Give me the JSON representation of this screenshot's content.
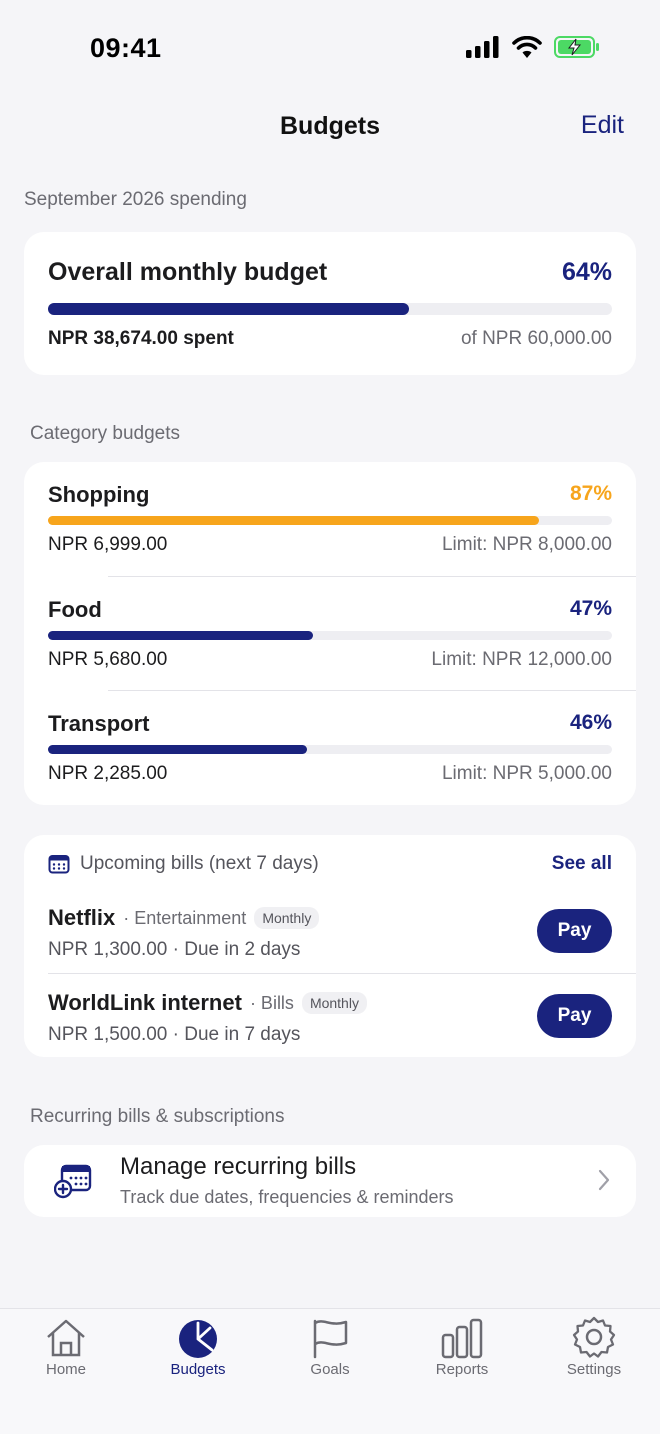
{
  "status_bar": {
    "time": "09:41"
  },
  "nav": {
    "title": "Budgets",
    "edit_label": "Edit"
  },
  "spending": {
    "section_label": "September 2026 spending",
    "title": "Overall monthly budget",
    "percent_label": "64%",
    "progress": 0.64,
    "spent": "NPR 38,674.00 spent",
    "of_total": "of NPR 60,000.00"
  },
  "categories": {
    "section_label": "Category budgets",
    "items": [
      {
        "name": "Shopping",
        "percent_label": "87%",
        "progress": 0.87,
        "amount": "NPR 6,999.00",
        "limit": "Limit: NPR 8,000.00",
        "color": "#f7a51c"
      },
      {
        "name": "Food",
        "percent_label": "47%",
        "progress": 0.47,
        "amount": "NPR 5,680.00",
        "limit": "Limit: NPR 12,000.00",
        "color": "#1a237e"
      },
      {
        "name": "Transport",
        "percent_label": "46%",
        "progress": 0.46,
        "amount": "NPR 2,285.00",
        "limit": "Limit: NPR 5,000.00",
        "color": "#1a237e"
      }
    ]
  },
  "bills": {
    "heading": "Upcoming bills (next 7 days)",
    "see_all": "See all",
    "items": [
      {
        "name": "Netflix",
        "category": "· Entertainment",
        "frequency": "Monthly",
        "details": "NPR 1,300.00 · Due in 2 days",
        "action": "Pay"
      },
      {
        "name": "WorldLink internet",
        "category": "· Bills",
        "frequency": "Monthly",
        "details": "NPR 1,500.00 · Due in 7 days",
        "action": "Pay"
      }
    ]
  },
  "recurring": {
    "section_label": "Recurring bills & subscriptions",
    "title": "Manage recurring bills",
    "subtitle": "Track due dates, frequencies & reminders"
  },
  "tabs": [
    {
      "label": "Home",
      "icon": "home-icon",
      "active": false
    },
    {
      "label": "Budgets",
      "icon": "budgets-pie-icon",
      "active": true
    },
    {
      "label": "Goals",
      "icon": "flag-icon",
      "active": false
    },
    {
      "label": "Reports",
      "icon": "bar-chart-icon",
      "active": false
    },
    {
      "label": "Settings",
      "icon": "gear-icon",
      "active": false
    }
  ],
  "colors": {
    "accent": "#1a237e",
    "warning": "#f7a51c",
    "background": "#f5f5f8"
  }
}
